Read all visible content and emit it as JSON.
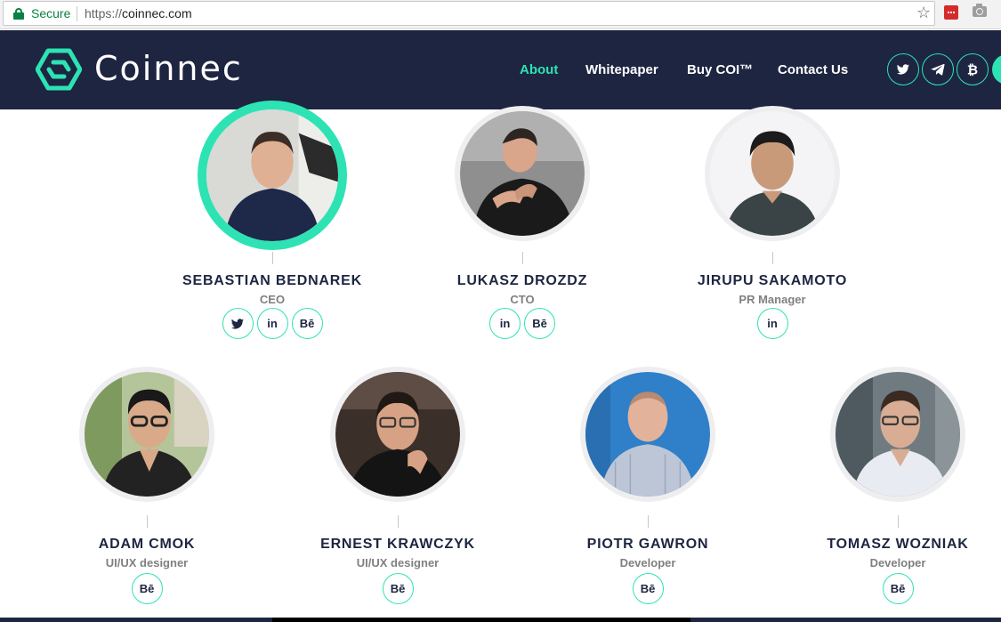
{
  "browser": {
    "secure_label": "Secure",
    "url_scheme": "https://",
    "url_host": "coinnec.com"
  },
  "site": {
    "brand": "Coinnec",
    "accent": "#2de3b4",
    "header_bg": "#1d2541",
    "nav": [
      {
        "label": "About",
        "active": true
      },
      {
        "label": "Whitepaper",
        "active": false
      },
      {
        "label": "Buy COI™",
        "active": false
      },
      {
        "label": "Contact Us",
        "active": false
      }
    ],
    "social_icons": [
      "twitter-icon",
      "telegram-icon",
      "bitcoin-icon"
    ]
  },
  "team": [
    {
      "name": "SEBASTIAN BEDNAREK",
      "role": "CEO",
      "links": [
        "twitter",
        "linkedin",
        "behance"
      ],
      "featured": true
    },
    {
      "name": "LUKASZ DROZDZ",
      "role": "CTO",
      "links": [
        "linkedin",
        "behance"
      ]
    },
    {
      "name": "JIRUPU SAKAMOTO",
      "role": "PR Manager",
      "links": [
        "linkedin"
      ]
    },
    {
      "name": "ADAM CMOK",
      "role": "UI/UX designer",
      "links": [
        "behance"
      ]
    },
    {
      "name": "ERNEST KRAWCZYK",
      "role": "UI/UX designer",
      "links": [
        "behance"
      ]
    },
    {
      "name": "PIOTR GAWRON",
      "role": "Developer",
      "links": [
        "behance"
      ]
    },
    {
      "name": "TOMASZ WOZNIAK",
      "role": "Developer",
      "links": [
        "behance"
      ]
    }
  ],
  "link_labels": {
    "linkedin": "in",
    "behance": "Bē"
  }
}
